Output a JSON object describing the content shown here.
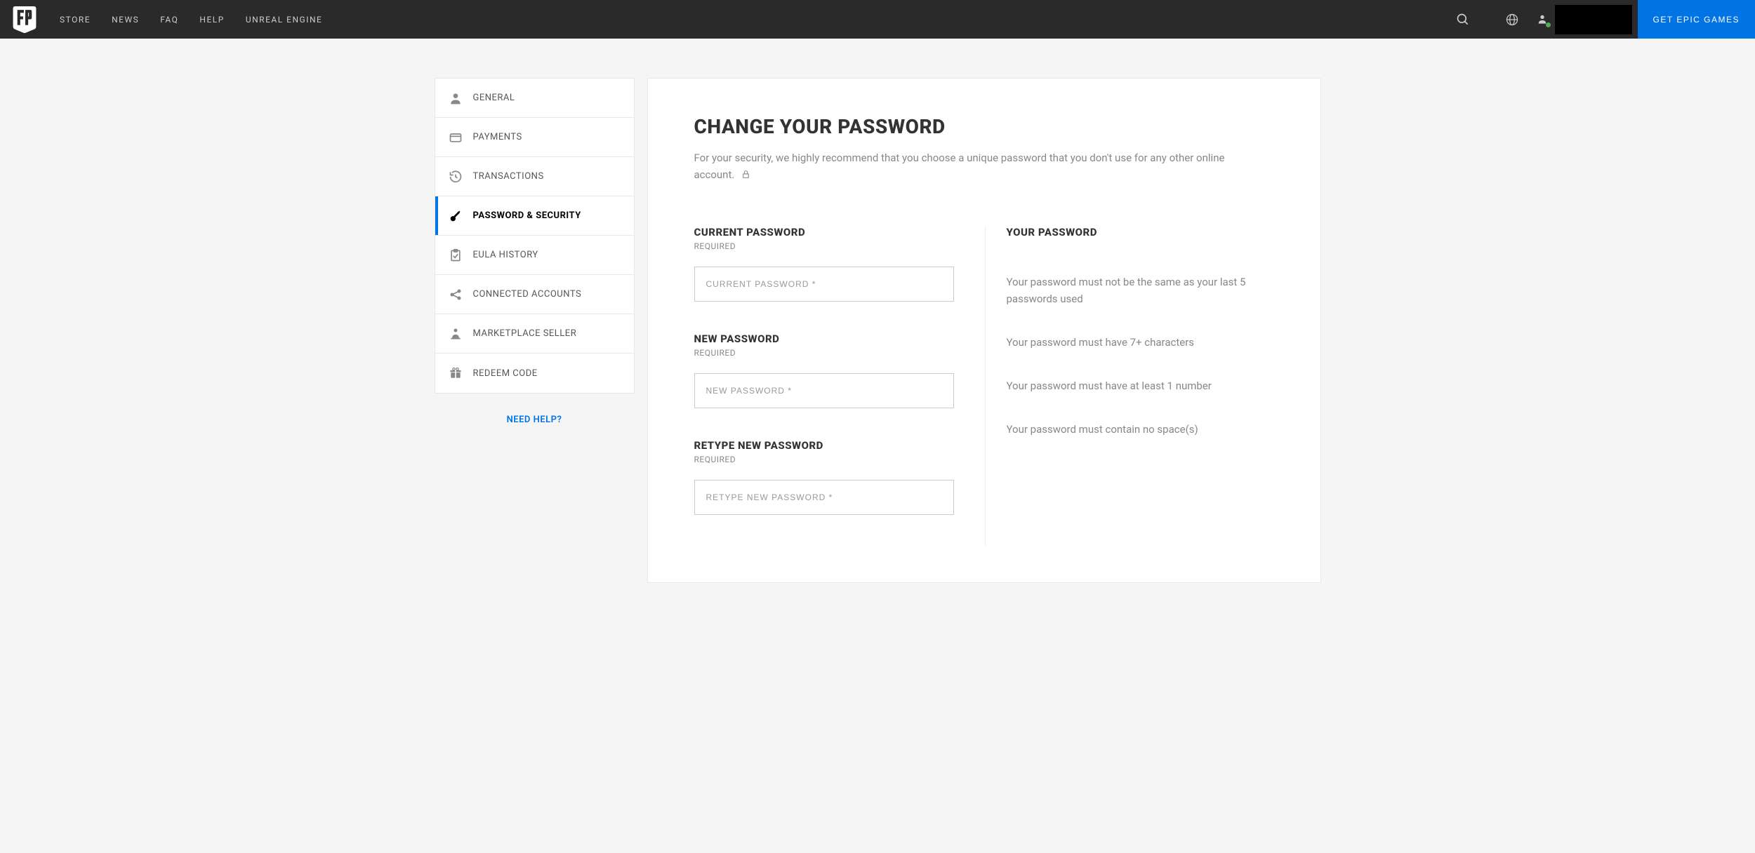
{
  "header": {
    "nav": [
      "STORE",
      "NEWS",
      "FAQ",
      "HELP",
      "UNREAL ENGINE"
    ],
    "cta": "GET EPIC GAMES"
  },
  "sidebar": {
    "items": [
      {
        "label": "GENERAL"
      },
      {
        "label": "PAYMENTS"
      },
      {
        "label": "TRANSACTIONS"
      },
      {
        "label": "PASSWORD & SECURITY"
      },
      {
        "label": "EULA HISTORY"
      },
      {
        "label": "CONNECTED ACCOUNTS"
      },
      {
        "label": "MARKETPLACE SELLER"
      },
      {
        "label": "REDEEM CODE"
      }
    ],
    "help_link": "NEED HELP?"
  },
  "main": {
    "title": "CHANGE YOUR PASSWORD",
    "subtitle": "For your security, we highly recommend that you choose a unique password that you don't use for any other online account.",
    "fields": {
      "current": {
        "label": "CURRENT PASSWORD",
        "required": "REQUIRED",
        "placeholder": "CURRENT PASSWORD *"
      },
      "new": {
        "label": "NEW PASSWORD",
        "required": "REQUIRED",
        "placeholder": "NEW PASSWORD *"
      },
      "retype": {
        "label": "RETYPE NEW PASSWORD",
        "required": "REQUIRED",
        "placeholder": "RETYPE NEW PASSWORD *"
      }
    },
    "rules": {
      "title": "YOUR PASSWORD",
      "items": [
        "Your password must not be the same as your last 5 passwords used",
        "Your password must have 7+ characters",
        "Your password must have at least 1 number",
        "Your password must contain no space(s)"
      ]
    }
  }
}
